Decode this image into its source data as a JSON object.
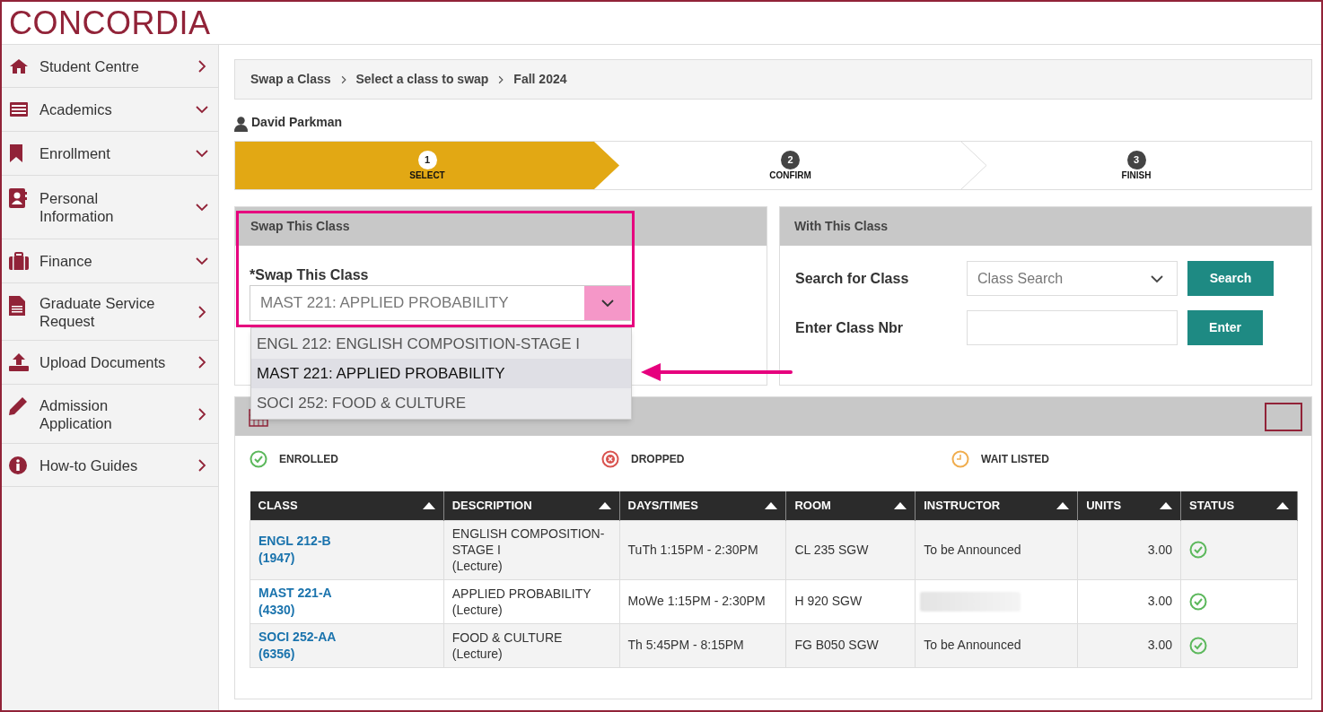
{
  "logo": "CONCORDIA",
  "sidebar": {
    "items": [
      {
        "label": "Student Centre",
        "expandable": false
      },
      {
        "label": "Academics",
        "expandable": true
      },
      {
        "label": "Enrollment",
        "expandable": true
      },
      {
        "label": "Personal Information",
        "expandable": true
      },
      {
        "label": "Finance",
        "expandable": true
      },
      {
        "label": "Graduate Service Request",
        "expandable": false
      },
      {
        "label": "Upload Documents",
        "expandable": false
      },
      {
        "label": "Admission Application",
        "expandable": false
      },
      {
        "label": "How-to Guides",
        "expandable": false
      }
    ]
  },
  "breadcrumb": [
    "Swap a Class",
    "Select a class to swap",
    "Fall 2024"
  ],
  "student_name": "David Parkman",
  "steps": [
    {
      "number": "1",
      "label": "SELECT",
      "selected": true
    },
    {
      "number": "2",
      "label": "CONFIRM",
      "selected": false
    },
    {
      "number": "3",
      "label": "FINISH",
      "selected": false
    }
  ],
  "swap_panel": {
    "title": "Swap This Class",
    "field_label": "*Swap This Class",
    "value": "MAST 221: APPLIED PROBABILITY",
    "expanded": true,
    "options": [
      {
        "label": "ENGL 212: ENGLISH COMPOSITION-STAGE I",
        "selected": false
      },
      {
        "label": "MAST 221: APPLIED PROBABILITY",
        "selected": true
      },
      {
        "label": "SOCI 252: FOOD & CULTURE",
        "selected": false
      }
    ]
  },
  "with_panel": {
    "title": "With This Class",
    "search_label": "Search for Class",
    "search_placeholder": "Class Search",
    "search_button": "Search",
    "nbr_label": "Enter Class Nbr",
    "enter_button": "Enter"
  },
  "legend": [
    {
      "label": "ENROLLED",
      "kind": "enrolled",
      "color": "#5cb85c"
    },
    {
      "label": "DROPPED",
      "kind": "dropped",
      "color": "#d9534f"
    },
    {
      "label": "WAIT LISTED",
      "kind": "waitlisted",
      "color": "#f0ad4e"
    }
  ],
  "table": {
    "columns": [
      "CLASS",
      "DESCRIPTION",
      "DAYS/TIMES",
      "ROOM",
      "INSTRUCTOR",
      "UNITS",
      "STATUS"
    ],
    "rows": [
      {
        "class": "ENGL 212-B",
        "nbr": "(1947)",
        "description": "ENGLISH COMPOSITION-STAGE I",
        "component": "(Lecture)",
        "days_times": "TuTh 1:15PM - 2:30PM",
        "room": "CL 235 SGW",
        "instructor": "To be Announced",
        "units": "3.00",
        "kind": "enrolled"
      },
      {
        "class": "MAST 221-A",
        "nbr": "(4330)",
        "description": "APPLIED PROBABILITY",
        "component": "(Lecture)",
        "days_times": "MoWe 1:15PM - 2:30PM",
        "room": "H 920 SGW",
        "instructor_blurred": true,
        "units": "3.00",
        "kind": "enrolled"
      },
      {
        "class": "SOCI 252-AA",
        "nbr": "(6356)",
        "description": "FOOD & CULTURE",
        "component": "(Lecture)",
        "days_times": "Th 5:45PM - 8:15PM",
        "room": "FG B050 SGW",
        "instructor": "To be Announced",
        "units": "3.00",
        "kind": "enrolled"
      }
    ]
  }
}
